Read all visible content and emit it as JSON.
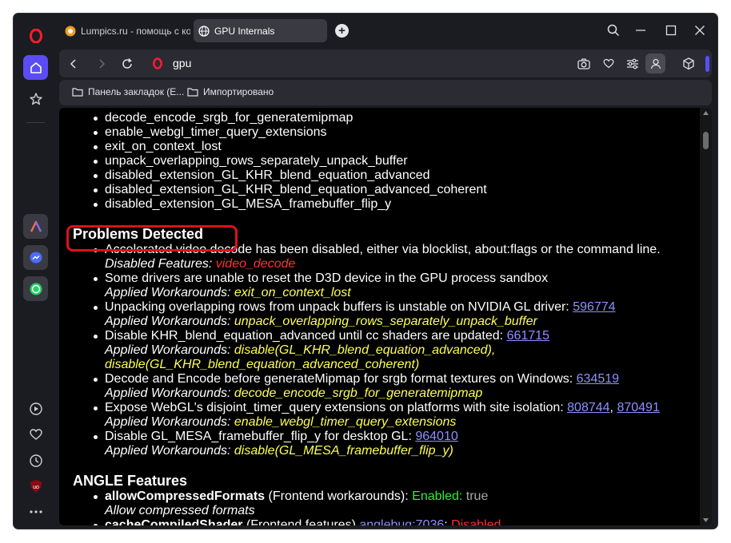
{
  "tabs": [
    {
      "title": "Lumpics.ru - помощь с ко"
    },
    {
      "title": "GPU Internals"
    }
  ],
  "address": {
    "text": "gpu"
  },
  "bookmarks": [
    {
      "label": "Панель закладок (E..."
    },
    {
      "label": "Импортировано"
    }
  ],
  "extensions_list": [
    "decode_encode_srgb_for_generatemipmap",
    "enable_webgl_timer_query_extensions",
    "exit_on_context_lost",
    "unpack_overlapping_rows_separately_unpack_buffer",
    "disabled_extension_GL_KHR_blend_equation_advanced",
    "disabled_extension_GL_KHR_blend_equation_advanced_coherent",
    "disabled_extension_GL_MESA_framebuffer_flip_y"
  ],
  "problems": {
    "heading": "Problems Detected",
    "items": [
      {
        "text": "Accelerated video decode has been disabled, either via blocklist, about:flags or the command line.",
        "sublabel": "Disabled Features:",
        "subvalue": "video_decode"
      },
      {
        "text": "Some drivers are unable to reset the D3D device in the GPU process sandbox",
        "sublabel": "Applied Workarounds:",
        "subvalue": "exit_on_context_lost"
      },
      {
        "text": "Unpacking overlapping rows from unpack buffers is unstable on NVIDIA GL driver:",
        "link": "596774",
        "sublabel": "Applied Workarounds:",
        "subvalue": "unpack_overlapping_rows_separately_unpack_buffer"
      },
      {
        "text": "Disable KHR_blend_equation_advanced until cc shaders are updated:",
        "link": "661715",
        "sublabel": "Applied Workarounds:",
        "subvalue": "disable(GL_KHR_blend_equation_advanced),",
        "subvalue2": "disable(GL_KHR_blend_equation_advanced_coherent)"
      },
      {
        "text": "Decode and Encode before generateMipmap for srgb format textures on Windows:",
        "link": "634519",
        "sublabel": "Applied Workarounds:",
        "subvalue": "decode_encode_srgb_for_generatemipmap"
      },
      {
        "text": "Expose WebGL's disjoint_timer_query extensions on platforms with site isolation:",
        "link": "808744",
        "sep": ",",
        "link2": "870491",
        "sublabel": "Applied Workarounds:",
        "subvalue": "enable_webgl_timer_query_extensions"
      },
      {
        "text": "Disable GL_MESA_framebuffer_flip_y for desktop GL:",
        "link": "964010",
        "sublabel": "Applied Workarounds:",
        "subvalue": "disable(GL_MESA_framebuffer_flip_y)"
      }
    ]
  },
  "angle": {
    "heading": "ANGLE Features",
    "items": [
      {
        "name": "allowCompressedFormats",
        "category": "(Frontend workarounds):",
        "status": "Enabled:",
        "value": "true",
        "desc": "Allow compressed formats"
      },
      {
        "name": "cacheCompiledShader",
        "category": "(Frontend features)",
        "link": "anglebug:7036",
        "status": "Disabled"
      }
    ]
  },
  "colors": {
    "accent": "#5b4cf5",
    "window_bg": "#1b1c21",
    "bar_bg": "#2b2c33",
    "workaround_yellow": "#ffff55",
    "disabled_red": "#ff3030",
    "enabled_green": "#33ee33",
    "link_blue": "#8f8fff",
    "highlight_box": "#e0101a"
  }
}
